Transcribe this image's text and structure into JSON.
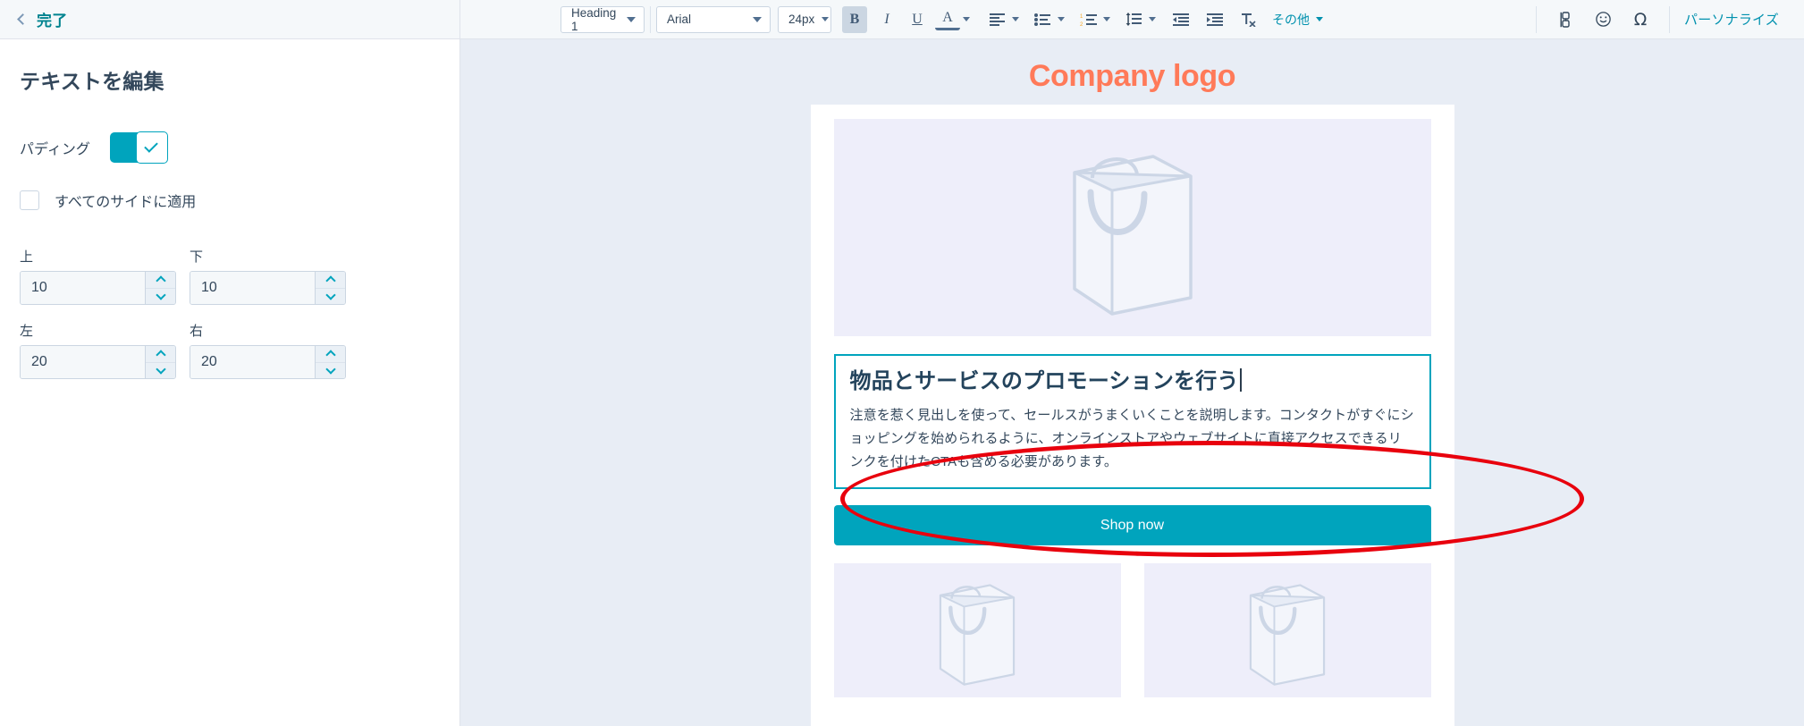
{
  "left_panel": {
    "back_label": "完了",
    "title": "テキストを編集",
    "padding_label": "パディング",
    "apply_all_label": "すべてのサイドに適用",
    "fields": [
      {
        "label": "上",
        "value": "10"
      },
      {
        "label": "下",
        "value": "10"
      },
      {
        "label": "左",
        "value": "20"
      },
      {
        "label": "右",
        "value": "20"
      }
    ]
  },
  "toolbar": {
    "style_select": "Heading 1",
    "font_select": "Arial",
    "size_select": "24px",
    "bold": "B",
    "italic": "I",
    "underline": "U",
    "font_color": "A",
    "more_label": "その他",
    "personalize_label": "パーソナライズ",
    "omega": "Ω",
    "smiley": "☺"
  },
  "canvas": {
    "company_logo": "Company logo",
    "heading": "物品とサービスのプロモーションを行う",
    "paragraph": "注意を惹く見出しを使って、セールスがうまくいくことを説明します。コンタクトがすぐにショッピングを始められるように、オンラインストアやウェブサイトに直接アクセスできるリンクを付けたCTAも含める必要があります。",
    "cta_label": "Shop now"
  },
  "colors": {
    "accent_teal": "#00a4bd",
    "link_teal": "#0091ae",
    "logo_orange": "#ff7a59",
    "text_dark": "#33475b",
    "annotation_red": "#e8000d",
    "panel_bg": "#f5f8fa",
    "canvas_bg": "#e8edf5",
    "placeholder_bg": "#eeeefa"
  }
}
